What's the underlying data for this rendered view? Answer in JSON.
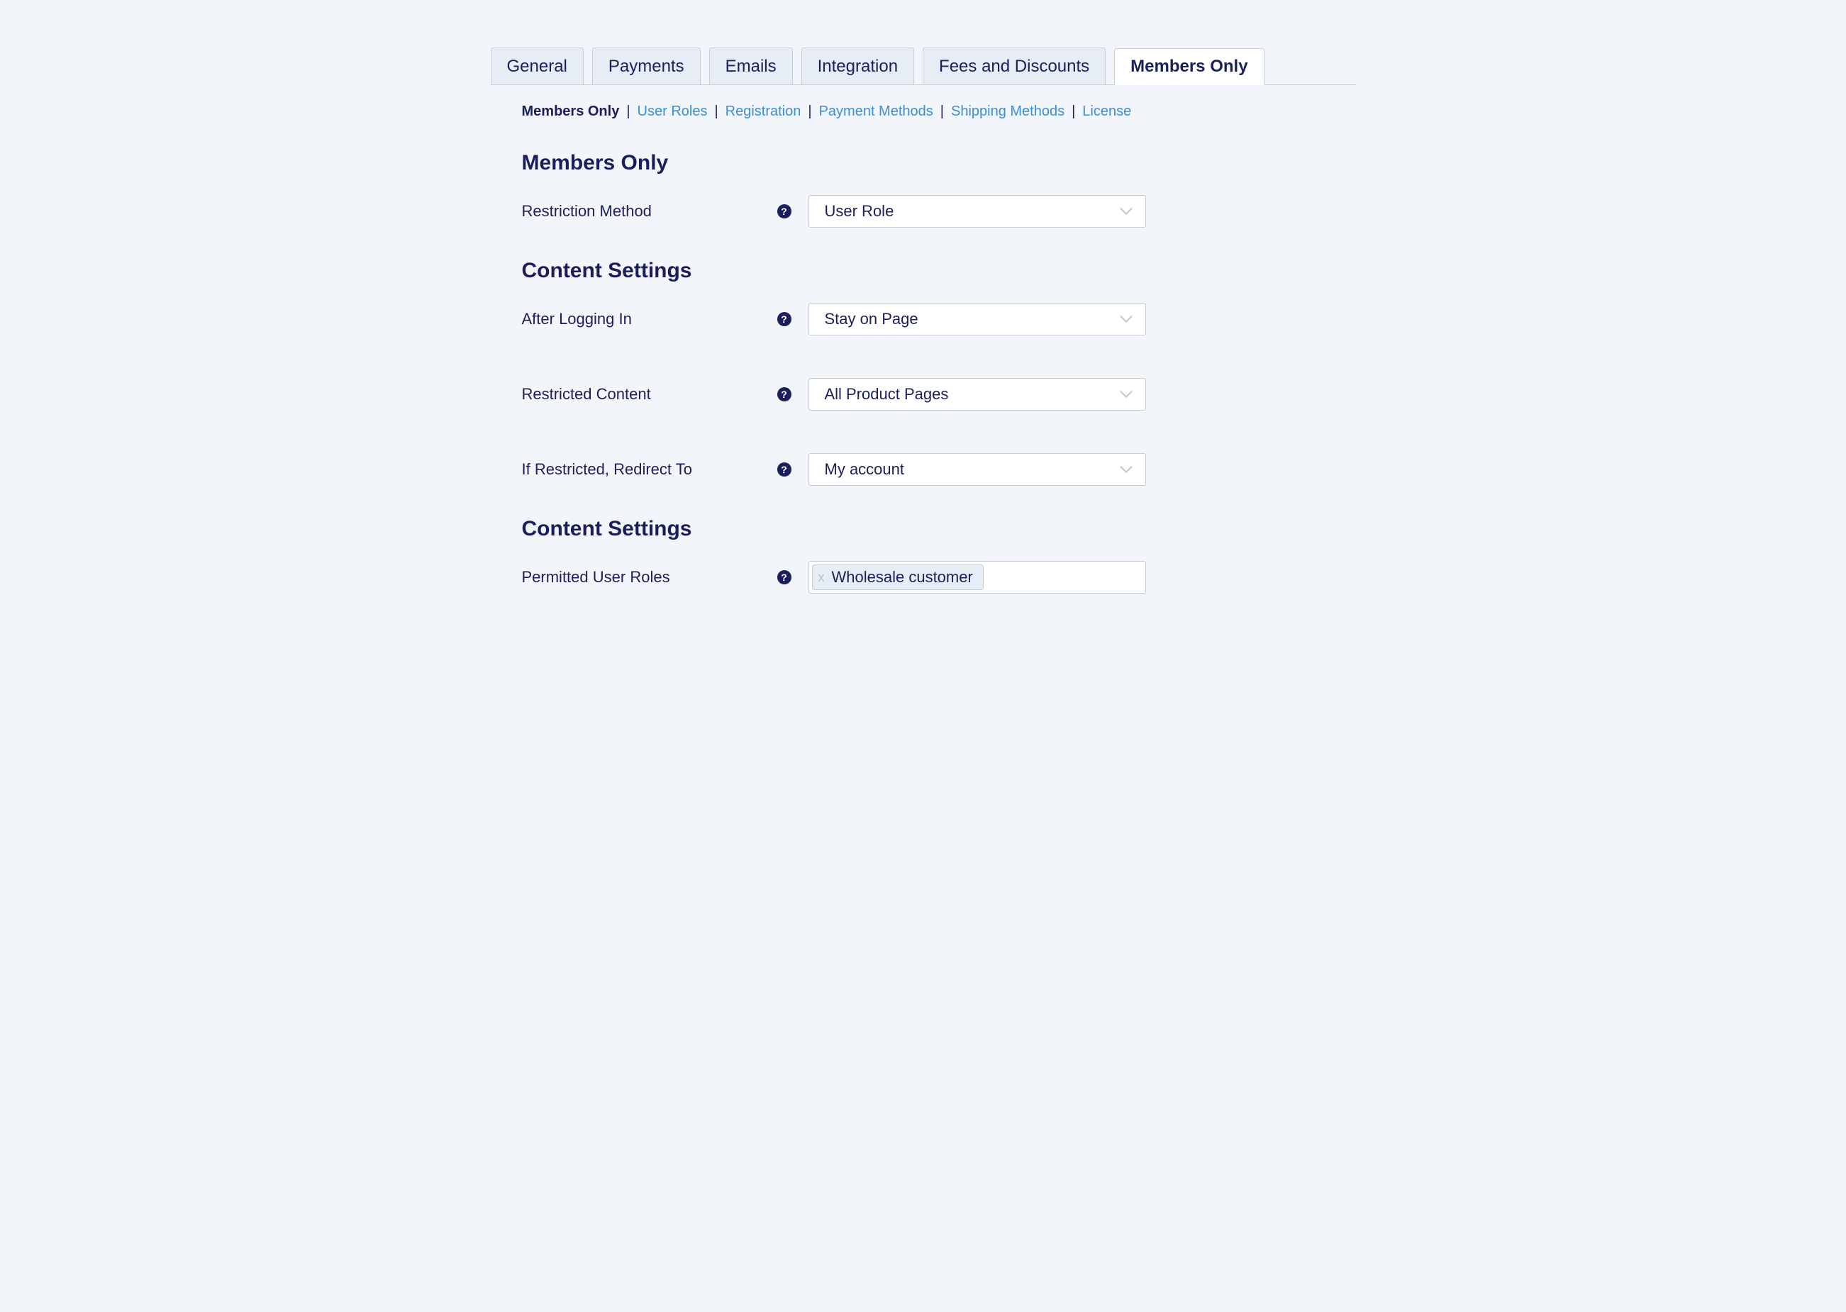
{
  "tabs": [
    {
      "label": "General",
      "active": false
    },
    {
      "label": "Payments",
      "active": false
    },
    {
      "label": "Emails",
      "active": false
    },
    {
      "label": "Integration",
      "active": false
    },
    {
      "label": "Fees and Discounts",
      "active": false
    },
    {
      "label": "Members Only",
      "active": true
    }
  ],
  "subnav": [
    {
      "label": "Members Only",
      "current": true
    },
    {
      "label": "User Roles",
      "current": false
    },
    {
      "label": "Registration",
      "current": false
    },
    {
      "label": "Payment Methods",
      "current": false
    },
    {
      "label": "Shipping Methods",
      "current": false
    },
    {
      "label": "License",
      "current": false
    }
  ],
  "section1_title": "Members Only",
  "section2_title": "Content Settings",
  "section3_title": "Content Settings",
  "fields": {
    "restriction_method": {
      "label": "Restriction Method",
      "value": "User Role"
    },
    "after_login": {
      "label": "After Logging In",
      "value": "Stay on Page"
    },
    "restricted_content": {
      "label": "Restricted Content",
      "value": "All Product Pages"
    },
    "redirect_to": {
      "label": "If Restricted, Redirect To",
      "value": "My account"
    },
    "permitted_roles": {
      "label": "Permitted User Roles",
      "tags": [
        "Wholesale customer"
      ]
    }
  },
  "icons": {
    "help_glyph": "?",
    "tag_remove_glyph": "x"
  },
  "colors": {
    "page_bg": "#f2f5f9",
    "text_primary": "#1a1f5c",
    "link": "#3c8ed9",
    "tab_bg": "#e7edf5",
    "border": "#c6cbd4"
  }
}
